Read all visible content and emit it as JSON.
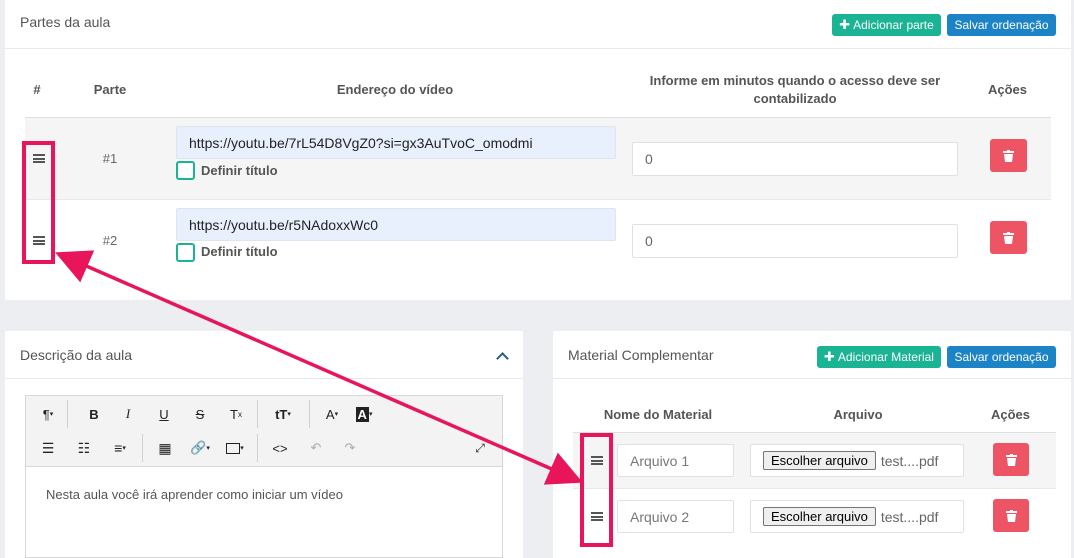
{
  "partes": {
    "title": "Partes da aula",
    "add_button": "Adicionar parte",
    "save_order_button": "Salvar ordenação",
    "columns": {
      "hash": "#",
      "parte": "Parte",
      "endereco": "Endereço do vídeo",
      "minutos": "Informe em minutos quando o acesso deve ser contabilizado",
      "acoes": "Ações"
    },
    "rows": [
      {
        "num": "#1",
        "url": "https://youtu.be/7rL54D8VgZ0?si=gx3AuTvoC_omodmi",
        "checkbox_label": "Definir título",
        "minutes": "0"
      },
      {
        "num": "#2",
        "url": "https://youtu.be/r5NAdoxxWc0",
        "checkbox_label": "Definir título",
        "minutes": "0"
      }
    ]
  },
  "descricao": {
    "title": "Descrição da aula",
    "toolbar_row1": [
      "¶",
      "B",
      "I",
      "U",
      "S",
      "Tx",
      "TT",
      "A",
      "A"
    ],
    "editor_text": "Nesta aula você irá aprender como iniciar um vídeo"
  },
  "material": {
    "title": "Material Complementar",
    "add_button": "Adicionar Material",
    "save_order_button": "Salvar ordenação",
    "columns": {
      "nome": "Nome do Material",
      "arquivo": "Arquivo",
      "acoes": "Ações"
    },
    "rows": [
      {
        "placeholder": "Arquivo 1",
        "file_button": "Escolher arquivo",
        "file_name": "test....pdf"
      },
      {
        "placeholder": "Arquivo 2",
        "file_button": "Escolher arquivo",
        "file_name": "test....pdf"
      }
    ]
  },
  "colors": {
    "green": "#1ab394",
    "blue": "#1c84c6",
    "danger": "#ed5565",
    "highlight": "#e8155a"
  }
}
